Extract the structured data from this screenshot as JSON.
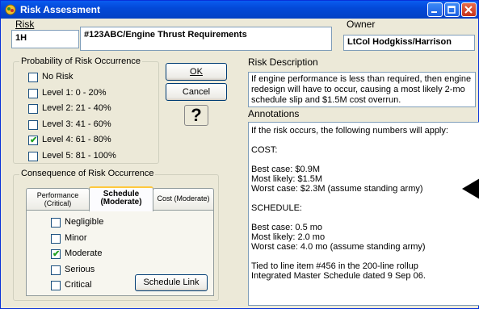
{
  "window": {
    "title": "Risk Assessment"
  },
  "risk": {
    "label": "Risk",
    "id_value": "1H",
    "title_value": "#123ABC/Engine Thrust Requirements"
  },
  "owner": {
    "label": "Owner",
    "value": "LtCol Hodgkiss/Harrison"
  },
  "probability": {
    "group_title": "Probability of Risk Occurrence",
    "options": [
      {
        "label": "No Risk",
        "checked": false
      },
      {
        "label": "Level 1:  0 - 20%",
        "checked": false
      },
      {
        "label": "Level 2:  21 - 40%",
        "checked": false
      },
      {
        "label": "Level 3:  41 - 60%",
        "checked": false
      },
      {
        "label": "Level 4:  61 - 80%",
        "checked": true
      },
      {
        "label": "Level 5:  81 - 100%",
        "checked": false
      }
    ]
  },
  "buttons": {
    "ok": "OK",
    "cancel": "Cancel",
    "help": "?"
  },
  "description": {
    "label": "Risk Description",
    "text": "If engine performance is less than required, then engine redesign will have to occur, causing a most likely 2-mo schedule slip and $1.5M cost overrun."
  },
  "annotations": {
    "label": "Annotations",
    "lines": [
      "If the risk occurs, the following numbers will apply:",
      "",
      "COST:",
      "",
      "Best case:  $0.9M",
      "Most likely:  $1.5M",
      "Worst case:  $2.3M (assume standing army)",
      "",
      "SCHEDULE:",
      "",
      "Best case:   0.5 mo",
      "Most likely:  2.0 mo",
      "Worst case:  4.0 mo (assume standing army)",
      "",
      "Tied to line item #456 in the 200-line rollup",
      "Integrated Master Schedule dated 9 Sep 06."
    ]
  },
  "consequence": {
    "group_title": "Consequence of Risk Occurrence",
    "tabs": [
      {
        "line1": "Performance",
        "line2": "(Critical)",
        "active": false
      },
      {
        "line1": "Schedule",
        "line2": "(Moderate)",
        "active": true
      },
      {
        "line1": "Cost (Moderate)",
        "line2": "",
        "active": false
      }
    ],
    "options": [
      {
        "label": "Negligible",
        "checked": false
      },
      {
        "label": "Minor",
        "checked": false
      },
      {
        "label": "Moderate",
        "checked": true
      },
      {
        "label": "Serious",
        "checked": false
      },
      {
        "label": "Critical",
        "checked": false
      }
    ],
    "link_button": "Schedule Link"
  }
}
